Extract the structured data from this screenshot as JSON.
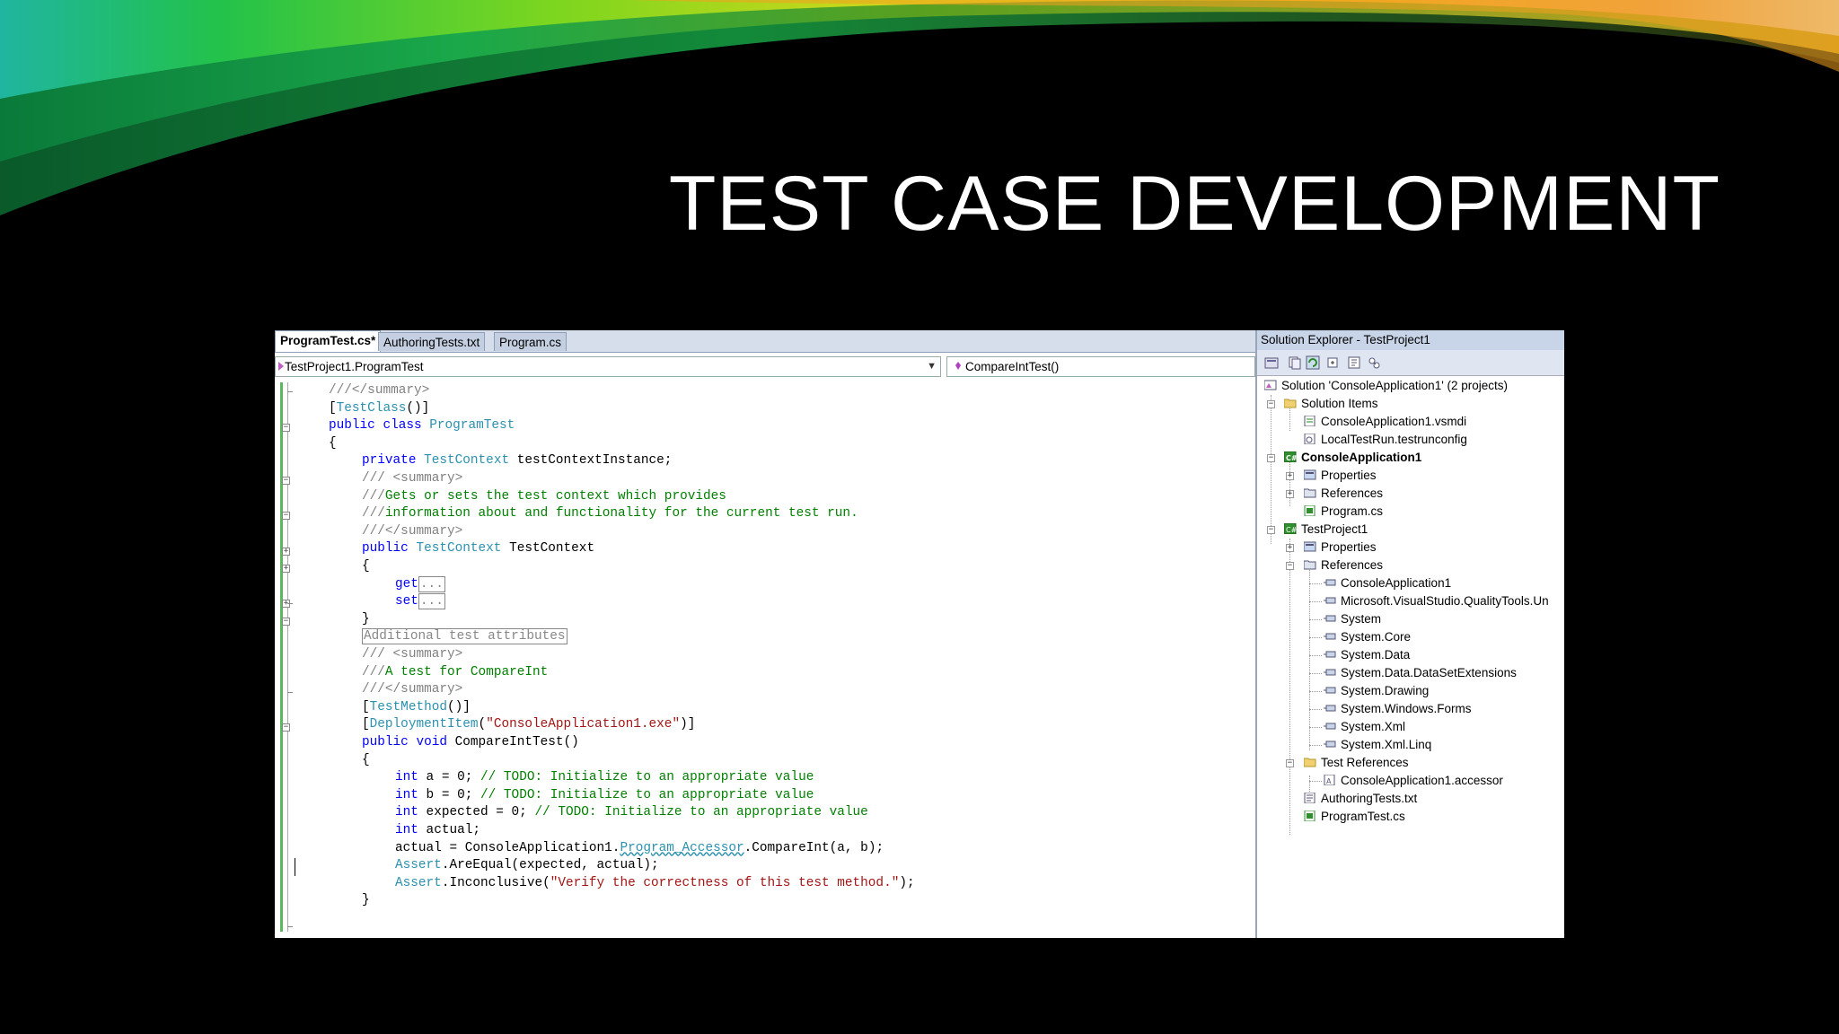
{
  "slide": {
    "title": "TEST CASE DEVELOPMENT"
  },
  "colors": {
    "keyword": "#0000ff",
    "type": "#2b91af",
    "comment": "#008000",
    "string": "#a31515",
    "doc_tag": "#808080"
  },
  "editor": {
    "tabs": [
      "ProgramTest.cs*",
      "AuthoringTests.txt",
      "Program.cs"
    ],
    "class_dropdown": "TestProject1.ProgramTest",
    "member_dropdown": "CompareIntTest()",
    "code": {
      "l0": "///</summary>",
      "l1a": "[",
      "l1b": "TestClass",
      "l1c": "()]",
      "l2a": "public class ",
      "l2b": "ProgramTest",
      "l3": "{",
      "l4a": "private ",
      "l4b": "TestContext",
      "l4c": " testContextInstance;",
      "l5a": "/// ",
      "l5b": "<summary>",
      "l6a": "///",
      "l6b": "Gets or sets the test context which provides",
      "l7a": "///",
      "l7b": "information about and functionality for the current test run.",
      "l8": "///</summary>",
      "l9a": "public ",
      "l9b": "TestContext",
      "l9c": " TestContext",
      "l10": "{",
      "l11a": "get",
      "l11b": "...",
      "l12a": "set",
      "l12b": "...",
      "l13": "}",
      "l14": "Additional test attributes",
      "l15a": "/// ",
      "l15b": "<summary>",
      "l16a": "///",
      "l16b": "A test for CompareInt",
      "l17": "///</summary>",
      "l18a": "[",
      "l18b": "TestMethod",
      "l18c": "()]",
      "l19a": "[",
      "l19b": "DeploymentItem",
      "l19c": "(",
      "l19d": "\"ConsoleApplication1.exe\"",
      "l19e": ")]",
      "l20a": "public void ",
      "l20b": "CompareIntTest()",
      "l21": "{",
      "l22a": "int",
      "l22b": " a = 0; ",
      "l22c": "// TODO: Initialize to an appropriate value",
      "l23a": "int",
      "l23b": " b = 0; ",
      "l23c": "// TODO: Initialize to an appropriate value",
      "l24a": "int",
      "l24b": " expected = 0; ",
      "l24c": "// TODO: Initialize to an appropriate value",
      "l25a": "int",
      "l25b": " actual;",
      "l26a": "actual = ConsoleApplication1.",
      "l26b": "Program_Accessor",
      "l26c": ".CompareInt(a, b);",
      "l27a": "Assert",
      "l27b": ".AreEqual(expected, actual);",
      "l28a": "Assert",
      "l28b": ".Inconclusive(",
      "l28c": "\"Verify the correctness of this test method.\"",
      "l28d": ");",
      "l29": "}"
    }
  },
  "solution_explorer": {
    "title": "Solution Explorer - TestProject1",
    "toolbar_icons": [
      "properties-icon",
      "show-all-files-icon",
      "refresh-icon",
      "view-code-icon",
      "view-designer-icon",
      "class-diagram-icon"
    ],
    "items": [
      "Solution 'ConsoleApplication1' (2 projects)",
      "Solution Items",
      "ConsoleApplication1.vsmdi",
      "LocalTestRun.testrunconfig",
      "ConsoleApplication1",
      "Properties",
      "References",
      "Program.cs",
      "TestProject1",
      "Properties",
      "References",
      "ConsoleApplication1",
      "Microsoft.VisualStudio.QualityTools.Un",
      "System",
      "System.Core",
      "System.Data",
      "System.Data.DataSetExtensions",
      "System.Drawing",
      "System.Windows.Forms",
      "System.Xml",
      "System.Xml.Linq",
      "Test References",
      "ConsoleApplication1.accessor",
      "AuthoringTests.txt",
      "ProgramTest.cs"
    ]
  }
}
